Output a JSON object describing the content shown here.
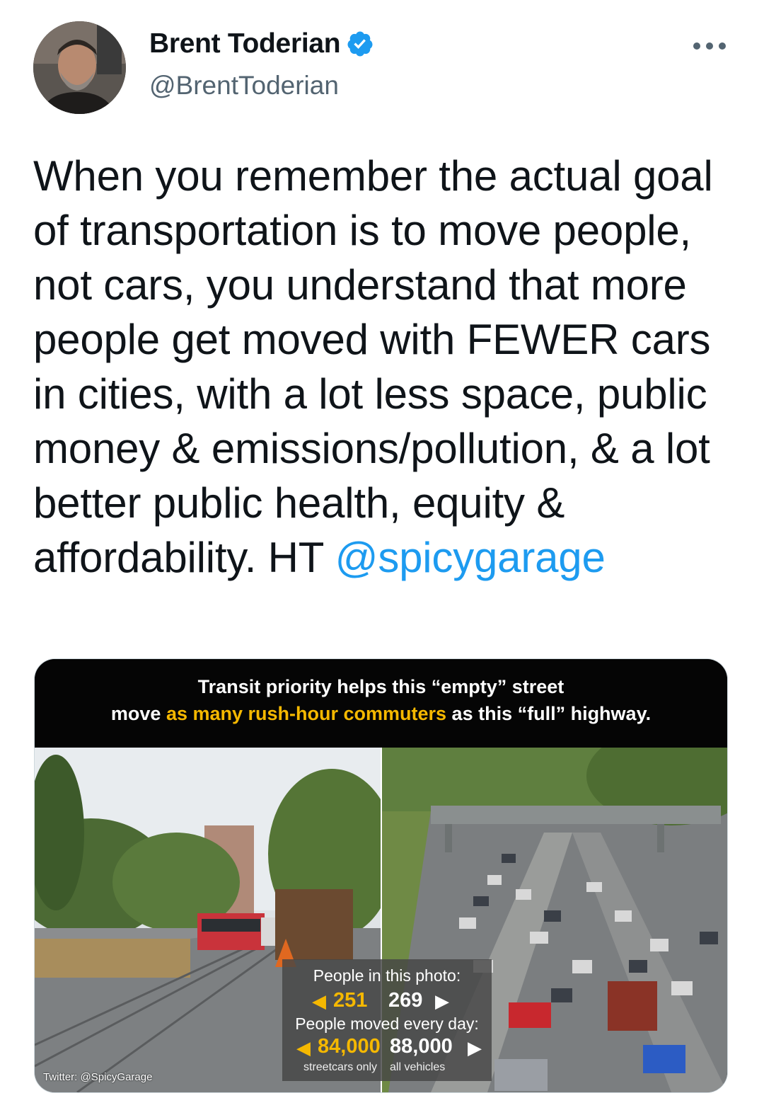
{
  "author": {
    "name": "Brent Toderian",
    "handle": "@BrentToderian",
    "verified": true
  },
  "tweet": {
    "text_before": "When you remember the actual goal of transportation is to move people, not cars, you understand that more people get moved with FEWER cars in cities, with a lot less space, public money & emissions/pollution, & a lot better public health, equity & affordability. HT ",
    "mention": "@spicygarage"
  },
  "media": {
    "banner_line1": "Transit priority helps this “empty” street",
    "banner_line2_pre": "move ",
    "banner_line2_highlight": "as many rush-hour commuters",
    "banner_line2_post": " as this “full” highway.",
    "stats": {
      "people_label": "People in this photo:",
      "people_left": "251",
      "people_right": "269",
      "moved_label": "People moved every day:",
      "moved_left": "84,000",
      "moved_right": "88,000",
      "left_caption": "streetcars only",
      "right_caption": "all vehicles"
    },
    "credit": "Twitter: @SpicyGarage"
  },
  "colors": {
    "accent": "#1d9bf0",
    "highlight": "#f5b800",
    "secondary_text": "#536471"
  },
  "icons": {
    "verified": "verified-badge-icon",
    "more": "more-options-icon"
  }
}
